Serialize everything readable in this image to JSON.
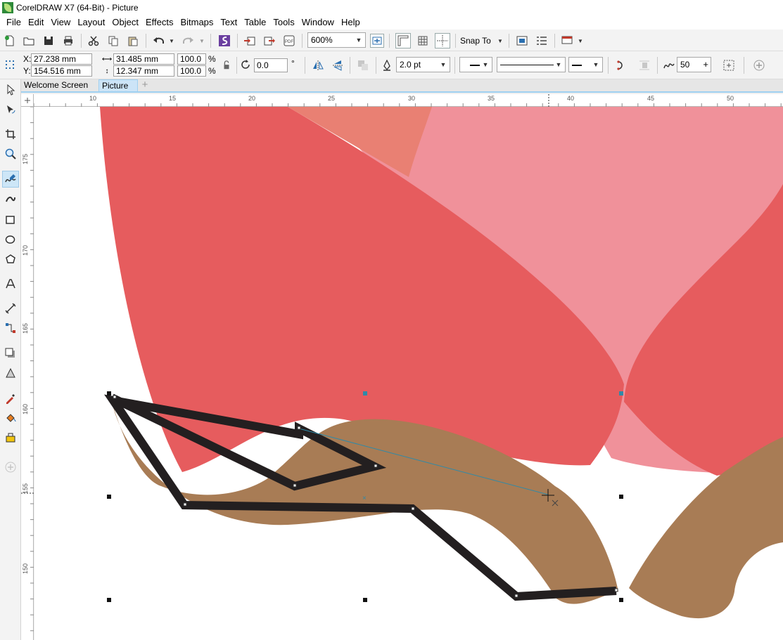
{
  "window": {
    "title": "CorelDRAW X7 (64-Bit) - Picture"
  },
  "menu": [
    "File",
    "Edit",
    "View",
    "Layout",
    "Object",
    "Effects",
    "Bitmaps",
    "Text",
    "Table",
    "Tools",
    "Window",
    "Help"
  ],
  "toolbar": {
    "zoom_value": "600%",
    "snap_label": "Snap To"
  },
  "property_bar": {
    "x_label": "X:",
    "x_value": "27.238 mm",
    "y_label": "Y:",
    "y_value": "154.516 mm",
    "width_value": "31.485 mm",
    "height_value": "12.347 mm",
    "scale_x": "100.0",
    "scale_y": "100.0",
    "percent_symbol": "%",
    "rotation_value": "0.0",
    "degree_symbol": "°",
    "outline_width": "2.0 pt",
    "smoothing_value": "50"
  },
  "tabs": [
    {
      "label": "Welcome Screen",
      "active": false
    },
    {
      "label": "Picture",
      "active": true
    }
  ],
  "ruler": {
    "top_labels": [
      "10",
      "15",
      "20",
      "25",
      "30",
      "35",
      "40",
      "45",
      "50"
    ],
    "left_labels": [
      "175",
      "170",
      "165",
      "160",
      "155",
      "150"
    ]
  },
  "colors": {
    "petal_red": "#e65c5e",
    "petal_pink": "#f0919a",
    "petal_salmon": "#e98073",
    "stem_brown": "#a87c55",
    "stroke_black": "#231f20",
    "accent_blue": "#2f8aa8"
  }
}
